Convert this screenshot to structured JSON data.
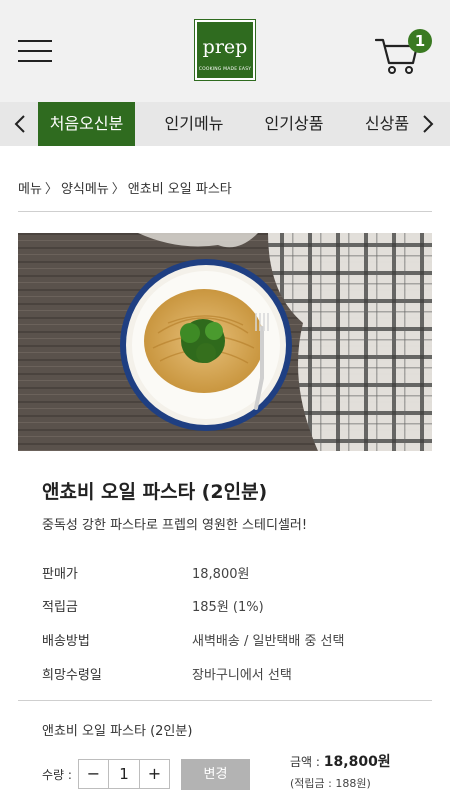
{
  "header": {
    "logo_word": "prep",
    "logo_tagline": "COOKING MADE EASY",
    "cart_count": "1"
  },
  "tabs": {
    "items": [
      {
        "label": "처음오신분",
        "active": true
      },
      {
        "label": "인기메뉴",
        "active": false
      },
      {
        "label": "인기상품",
        "active": false
      },
      {
        "label": "신상품",
        "active": false
      }
    ],
    "prev_arrow": "‹",
    "next_arrow": "›"
  },
  "breadcrumb": {
    "items": [
      "메뉴",
      "양식메뉴",
      "앤쵸비 오일 파스타"
    ],
    "separator": "〉"
  },
  "product": {
    "image_icon": "pasta-plate-image",
    "title": "앤쵸비 오일 파스타 (2인분)",
    "subtitle": "중독성 강한 파스타로 프렙의 영원한 스테디셀러!",
    "info": [
      {
        "label": "판매가",
        "value": "18,800원"
      },
      {
        "label": "적립금",
        "value": "185원 (1%)"
      },
      {
        "label": "배송방법",
        "value": "새벽배송 / 일반택배 중 선택"
      },
      {
        "label": "희망수령일",
        "value": "장바구니에서 선택"
      }
    ]
  },
  "order": {
    "item_name": "앤쵸비 오일 파스타 (2인분)",
    "qty_label": "수량 :",
    "minus": "−",
    "plus": "+",
    "quantity": "1",
    "change_label": "변경",
    "total_label": "금액 :",
    "total_value": "18,800원",
    "points_text": "(적립금 : 188원)"
  },
  "colors": {
    "brand_green": "#2f6b1f",
    "badge_green": "#3a7a22",
    "button_gray": "#b3b3b3"
  }
}
